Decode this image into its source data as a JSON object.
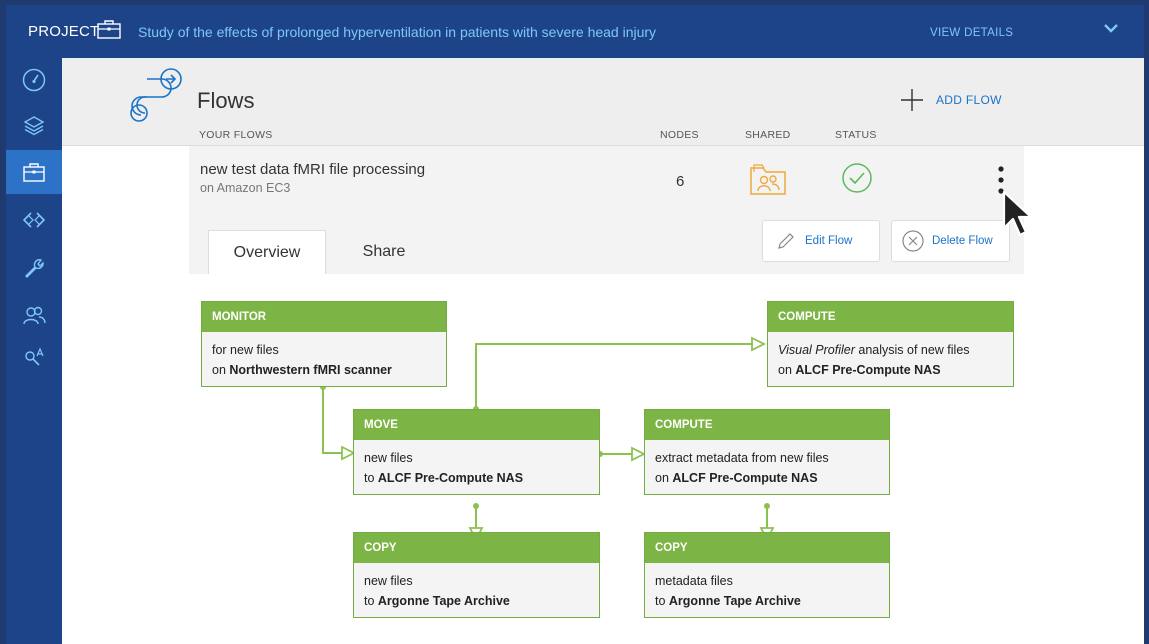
{
  "header": {
    "project_label": "PROJECT",
    "project_title": "Study of the effects of prolonged hyperventilation in patients with severe head injury",
    "view_details": "VIEW DETAILS"
  },
  "sidebar": {
    "items": [
      {
        "icon": "dashboard-icon",
        "active": false
      },
      {
        "icon": "layers-icon",
        "active": false
      },
      {
        "icon": "briefcase-icon",
        "active": true
      },
      {
        "icon": "code-icon",
        "active": false
      },
      {
        "icon": "wrench-icon",
        "active": false
      },
      {
        "icon": "users-icon",
        "active": false
      },
      {
        "icon": "search-translate-icon",
        "active": false
      }
    ]
  },
  "flows": {
    "title": "Flows",
    "add_label": "ADD FLOW",
    "columns": {
      "your_flows": "YOUR FLOWS",
      "nodes": "NODES",
      "shared": "SHARED",
      "status": "STATUS"
    },
    "row": {
      "name": "new test data fMRI file processing",
      "location": "on Amazon EC3",
      "nodes": "6"
    },
    "tabs": [
      "Overview",
      "Share"
    ],
    "edit_label": "Edit Flow",
    "delete_label": "Delete Flow"
  },
  "diagram": {
    "nodes": [
      {
        "id": "monitor",
        "type": "MONITOR",
        "line1": "for new files",
        "line2_prefix": "on ",
        "line2_bold": "Northwestern fMRI scanner"
      },
      {
        "id": "move",
        "type": "MOVE",
        "line1": "new files",
        "line2_prefix": "to ",
        "line2_bold": "ALCF Pre-Compute NAS"
      },
      {
        "id": "compute1",
        "type": "COMPUTE",
        "line1": "extract metadata from new files",
        "line2_prefix": "on ",
        "line2_bold": "ALCF Pre-Compute NAS"
      },
      {
        "id": "compute2",
        "type": "COMPUTE",
        "line1_italic": "Visual Profiler",
        "line1_rest": " analysis of new files",
        "line2_prefix": "on ",
        "line2_bold": "ALCF Pre-Compute NAS"
      },
      {
        "id": "copy1",
        "type": "COPY",
        "line1": "new files",
        "line2_prefix": "to ",
        "line2_bold": "Argonne Tape Archive"
      },
      {
        "id": "copy2",
        "type": "COPY",
        "line1": "metadata files",
        "line2_prefix": "to ",
        "line2_bold": "Argonne Tape Archive"
      }
    ]
  },
  "colors": {
    "header_bg": "#1d4388",
    "accent_link": "#7ec8f8",
    "active_sidebar": "#2c72c7",
    "node_green": "#7cb445",
    "action_blue": "#1a73c9"
  }
}
